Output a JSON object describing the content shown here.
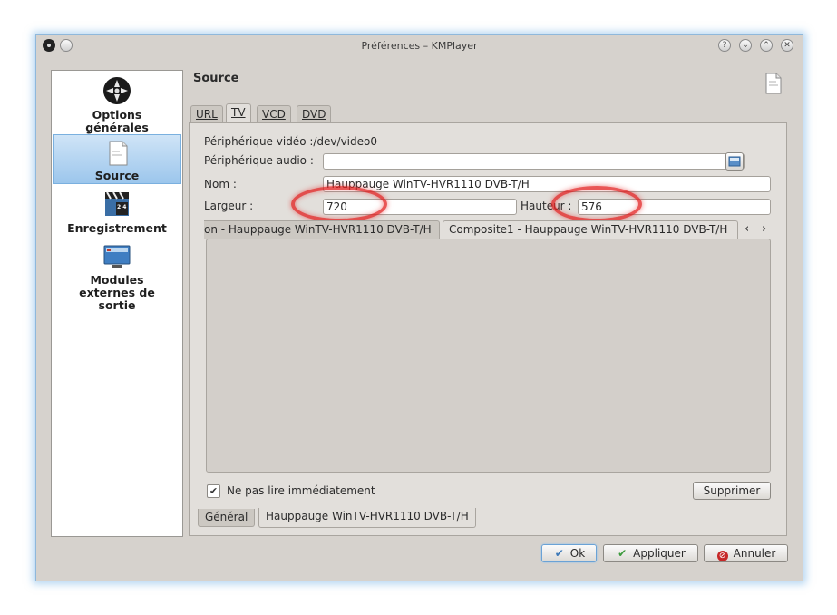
{
  "window": {
    "title": "Préférences – KMPlayer",
    "titlebar_buttons": [
      {
        "name": "help-icon",
        "glyph": "?"
      },
      {
        "name": "minimize-icon",
        "glyph": "⌄"
      },
      {
        "name": "maximize-icon",
        "glyph": "⌃"
      },
      {
        "name": "close-icon",
        "glyph": "✕"
      }
    ]
  },
  "sidebar": {
    "items": [
      {
        "label_line1": "Options",
        "label_line2": "générales",
        "icon": "film-reel-icon"
      },
      {
        "label": "Source",
        "icon": "document-icon",
        "selected": true
      },
      {
        "label": "Enregistrement",
        "icon": "clapperboard-icon"
      },
      {
        "label_line1": "Modules",
        "label_line2": "externes de",
        "label_line3": "sortie",
        "icon": "monitor-icon"
      }
    ]
  },
  "section": {
    "title": "Source"
  },
  "tabs": {
    "url": "URL",
    "tv": "TV",
    "vcd": "VCD",
    "dvd": "DVD",
    "active": "TV"
  },
  "tv": {
    "video_device_label": "Périphérique vidéo :/dev/video0",
    "audio_device_label": "Périphérique audio :",
    "audio_device_value": "",
    "name_label": "Nom :",
    "name_value": "Hauppauge WinTV-HVR1110 DVB-T/H",
    "width_label": "Largeur :",
    "width_value": "720",
    "height_label": "Hauteur :",
    "height_value": "576",
    "input_tabs": [
      "on - Hauppauge WinTV-HVR1110 DVB-T/H",
      "Composite1 - Hauppauge WinTV-HVR1110 DVB-T/H"
    ],
    "scroll_left": "‹",
    "scroll_right": "›",
    "no_play_label": "Ne pas lire immédiatement",
    "no_play_checked": true,
    "delete_button": "Supprimer"
  },
  "bottom_tabs": {
    "general": "Général",
    "device": "Hauppauge WinTV-HVR1110 DVB-T/H"
  },
  "dialog_buttons": {
    "ok": "Ok",
    "apply": "Appliquer",
    "cancel": "Annuler"
  },
  "colors": {
    "window_bg": "#d6d2cd",
    "selection": "#9cc6ec",
    "highlight_ring": "#e11e1e"
  }
}
